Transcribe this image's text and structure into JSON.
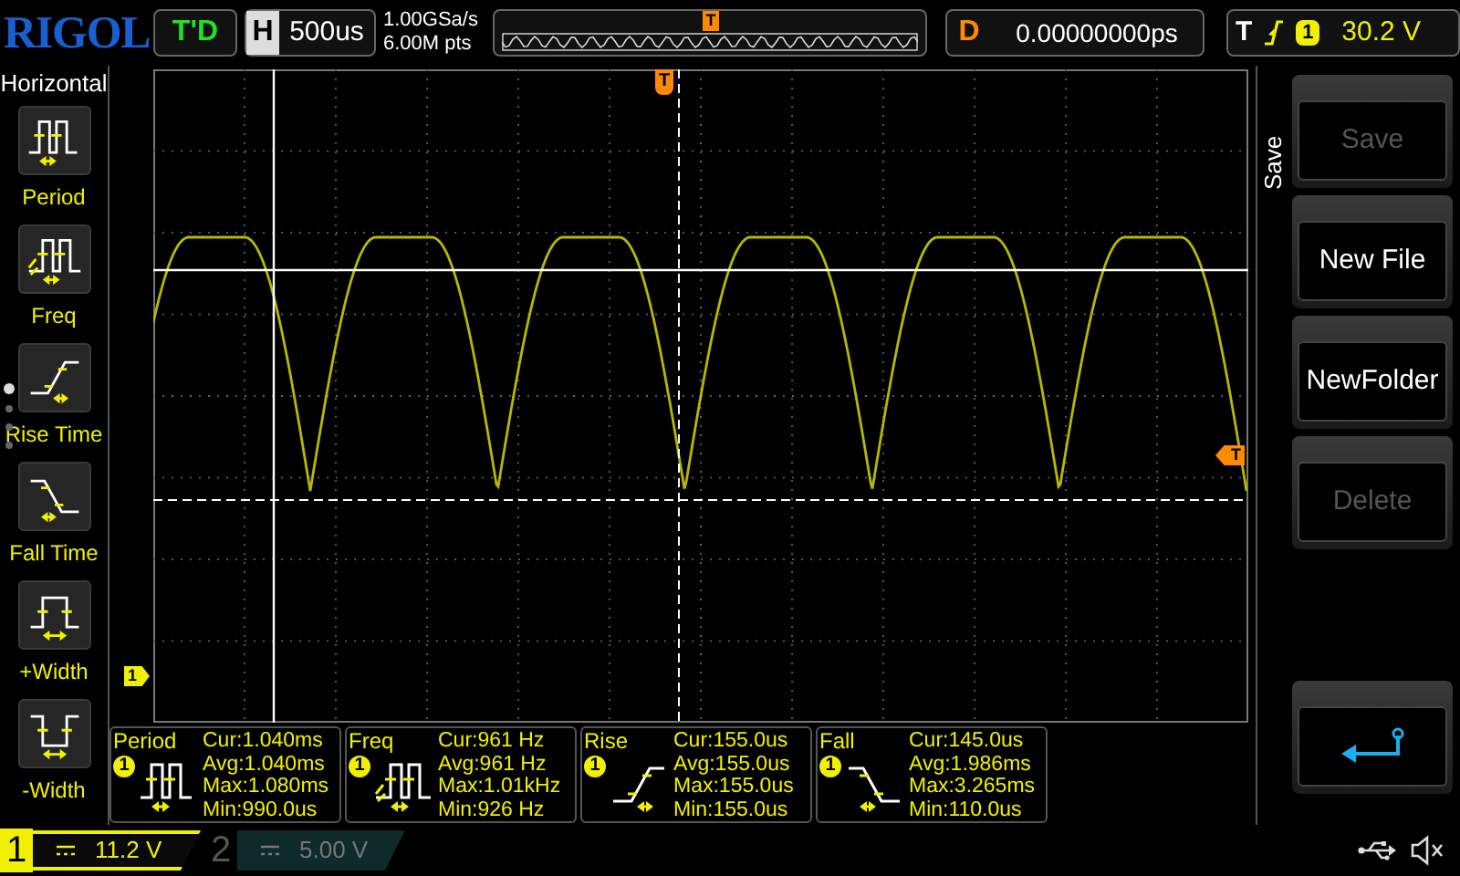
{
  "brand": "RIGOL",
  "run_status": "T'D",
  "horizontal": {
    "label": "H",
    "timebase": "500us"
  },
  "acquisition": {
    "sample_rate": "1.00GSa/s",
    "memory_depth": "6.00M pts"
  },
  "overview": {
    "trigger_marker": "T"
  },
  "delay": {
    "label": "D",
    "value": "0.00000000ps"
  },
  "trigger": {
    "label": "T",
    "source": "1",
    "level": "30.2 V"
  },
  "sidebar": {
    "title": "Horizontal",
    "items": [
      {
        "label": "Period",
        "kind": "period"
      },
      {
        "label": "Freq",
        "kind": "freq"
      },
      {
        "label": "Rise Time",
        "kind": "rise"
      },
      {
        "label": "Fall Time",
        "kind": "fall"
      },
      {
        "label": "+Width",
        "kind": "pwidth"
      },
      {
        "label": "-Width",
        "kind": "nwidth"
      }
    ],
    "pages": [
      {
        "selected": true
      },
      {
        "selected": false
      },
      {
        "selected": false
      },
      {
        "selected": false
      }
    ]
  },
  "screen": {
    "trigger_position_marker": "T",
    "trigger_level_marker": "T",
    "channel_marker": "1"
  },
  "measurements": [
    {
      "name": "Period",
      "source": "1",
      "kind": "period",
      "lines": [
        "Cur:1.040ms",
        "Avg:1.040ms",
        "Max:1.080ms",
        "Min:990.0us"
      ]
    },
    {
      "name": "Freq",
      "source": "1",
      "kind": "freq",
      "lines": [
        "Cur:961 Hz",
        "Avg:961 Hz",
        "Max:1.01kHz",
        "Min:926 Hz"
      ]
    },
    {
      "name": "Rise",
      "source": "1",
      "kind": "rise",
      "lines": [
        "Cur:155.0us",
        "Avg:155.0us",
        "Max:155.0us",
        "Min:155.0us"
      ]
    },
    {
      "name": "Fall",
      "source": "1",
      "kind": "fall",
      "lines": [
        "Cur:145.0us",
        "Avg:1.986ms",
        "Max:3.265ms",
        "Min:110.0us"
      ]
    }
  ],
  "channels": [
    {
      "number": "1",
      "scale": "11.2 V",
      "on": true
    },
    {
      "number": "2",
      "scale": "5.00 V",
      "on": false
    }
  ],
  "menu": {
    "title": "Save",
    "buttons": [
      {
        "kind": "text",
        "label": "Save",
        "disabled": true
      },
      {
        "kind": "text",
        "label": "New File",
        "disabled": false
      },
      {
        "kind": "text",
        "label": "NewFolder",
        "disabled": false
      },
      {
        "kind": "text",
        "label": "Delete",
        "disabled": true
      },
      {
        "kind": "gap"
      },
      {
        "kind": "back"
      }
    ]
  }
}
